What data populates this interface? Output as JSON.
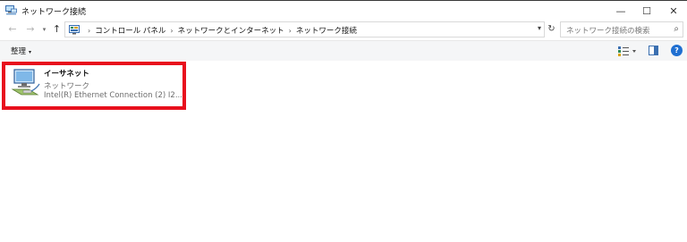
{
  "window": {
    "title": "ネットワーク接続",
    "minimize_glyph": "—",
    "maximize_glyph": "☐",
    "close_glyph": "✕"
  },
  "nav": {
    "back_glyph": "←",
    "forward_glyph": "→",
    "recent_glyph": "▾",
    "up_glyph": "↑",
    "refresh_glyph": "↻",
    "dropdown_glyph": "▾",
    "breadcrumbs": [
      "コントロール パネル",
      "ネットワークとインターネット",
      "ネットワーク接続"
    ],
    "separator": "›"
  },
  "search": {
    "placeholder": "ネットワーク接続の検索",
    "icon_glyph": "⌕"
  },
  "toolbar": {
    "organize_label": "整理",
    "organize_caret": "▾",
    "help_label": "?"
  },
  "connections": [
    {
      "name": "イーサネット",
      "type": "ネットワーク",
      "adapter": "Intel(R) Ethernet Connection (2) I2..."
    }
  ],
  "colors": {
    "highlight": "#e8101d",
    "help": "#1f6fd1"
  }
}
